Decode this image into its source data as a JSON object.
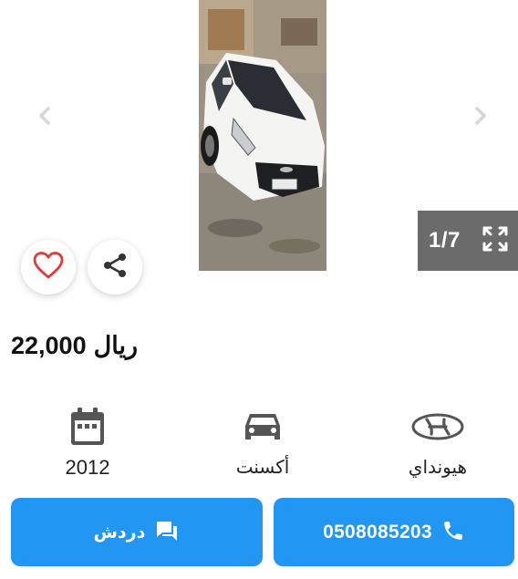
{
  "gallery": {
    "counter": "1/7"
  },
  "listing": {
    "price_value": "22,000",
    "price_currency": "ريال"
  },
  "specs": {
    "year": "2012",
    "model": "أكسنت",
    "brand": "هيونداي"
  },
  "actions": {
    "chat_label": "دردش",
    "phone": "0508085203"
  },
  "icons": {
    "prev": "chevron-left-icon",
    "next": "chevron-right-icon",
    "fullscreen": "expand-icon",
    "favorite": "heart-icon",
    "share": "share-icon",
    "calendar": "calendar-icon",
    "car": "car-icon",
    "brand_logo": "hyundai-logo-icon",
    "chat": "chat-icon",
    "phone": "phone-icon"
  },
  "colors": {
    "accent": "#2196f3",
    "heart": "#e53935",
    "counter_bg": "#6b6b6b"
  }
}
